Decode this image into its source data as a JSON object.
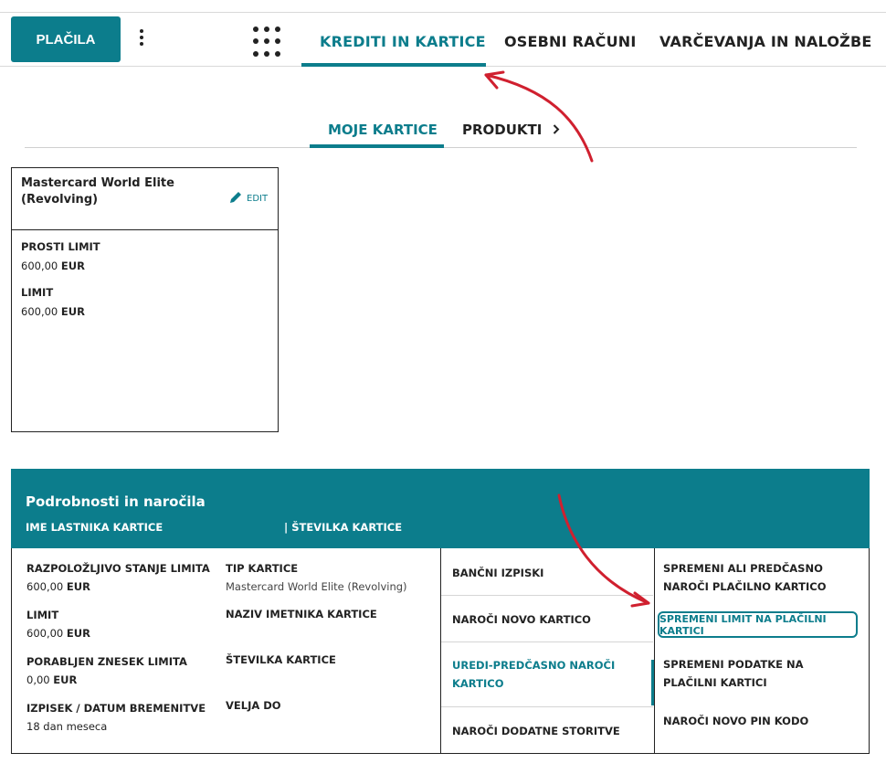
{
  "header": {
    "pay_button": "PLAČILA",
    "tabs": [
      "KREDITI IN KARTICE",
      "OSEBNI RAČUNI",
      "VARČEVANJA IN NALOŽBE"
    ]
  },
  "subnav": {
    "tabs": [
      "MOJE KARTICE",
      "PRODUKTI"
    ]
  },
  "card": {
    "name": "Mastercard World Elite (Revolving)",
    "edit": "EDIT",
    "free_limit_label": "PROSTI LIMIT",
    "free_limit_value": "600,00",
    "currency": "EUR",
    "limit_label": "LIMIT",
    "limit_value": "600,00"
  },
  "details": {
    "title": "Podrobnosti in naročila",
    "owner_label": "IME LASTNIKA KARTICE",
    "number_label": "| ŠTEVILKA KARTICE",
    "available_label": "RAZPOLOŽLJIVO STANJE LIMITA",
    "available_value": "600,00",
    "limit_label": "LIMIT",
    "limit_value": "600,00",
    "used_label": "PORABLJEN ZNESEK LIMITA",
    "used_value": "0,00",
    "statement_label": "IZPISEK / DATUM BREMENITVE",
    "statement_value": "18 dan meseca",
    "currency": "EUR",
    "type_label": "TIP KARTICE",
    "type_value": "Mastercard World Elite (Revolving)",
    "holder_label": "NAZIV IMETNIKA KARTICE",
    "card_number_label": "ŠTEVILKA KARTICE",
    "valid_label": "VELJA DO"
  },
  "menu": {
    "items": [
      "BANČNI IZPISKI",
      "NAROČI NOVO KARTICO",
      "UREDI-PREDČASNO NAROČI KARTICO",
      "NAROČI DODATNE STORITVE"
    ]
  },
  "options": {
    "items": [
      "SPREMENI ALI PREDČASNO NAROČI PLAČILNO KARTICO",
      "SPREMENI LIMIT NA PLAČILNI KARTICI",
      "SPREMENI PODATKE NA PLAČILNI KARTICI",
      "NAROČI NOVO PIN KODO"
    ]
  },
  "colors": {
    "accent": "#0c7d8c",
    "annotation": "#d0202f"
  }
}
